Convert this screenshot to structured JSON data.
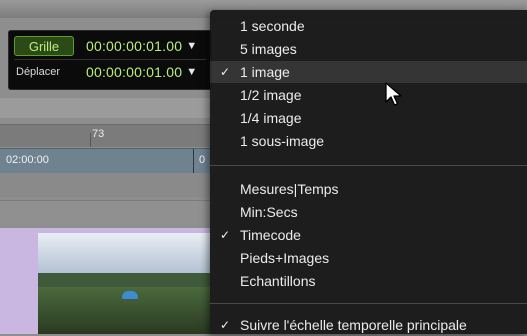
{
  "counter": {
    "grid_label": "Grille",
    "grid_value": "00:00:00:01.00",
    "nudge_label": "Déplacer",
    "nudge_value": "00:00:00:01.00"
  },
  "ruler": {
    "marker": "73"
  },
  "timecode_strip": {
    "left": "02:00:00",
    "right": "0"
  },
  "menu": {
    "group1": [
      {
        "label": "1 seconde",
        "checked": false
      },
      {
        "label": "5 images",
        "checked": false
      },
      {
        "label": "1 image",
        "checked": true
      },
      {
        "label": "1/2 image",
        "checked": false
      },
      {
        "label": "1/4 image",
        "checked": false
      },
      {
        "label": "1 sous-image",
        "checked": false
      }
    ],
    "group2": [
      {
        "label": "Mesures|Temps",
        "checked": false
      },
      {
        "label": "Min:Secs",
        "checked": false
      },
      {
        "label": "Timecode",
        "checked": true
      },
      {
        "label": "Pieds+Images",
        "checked": false
      },
      {
        "label": "Echantillons",
        "checked": false
      }
    ],
    "group3": [
      {
        "label": "Suivre l'échelle temporelle principale",
        "checked": true
      }
    ],
    "check_glyph": "✓",
    "dropdown_glyph": "▼"
  }
}
